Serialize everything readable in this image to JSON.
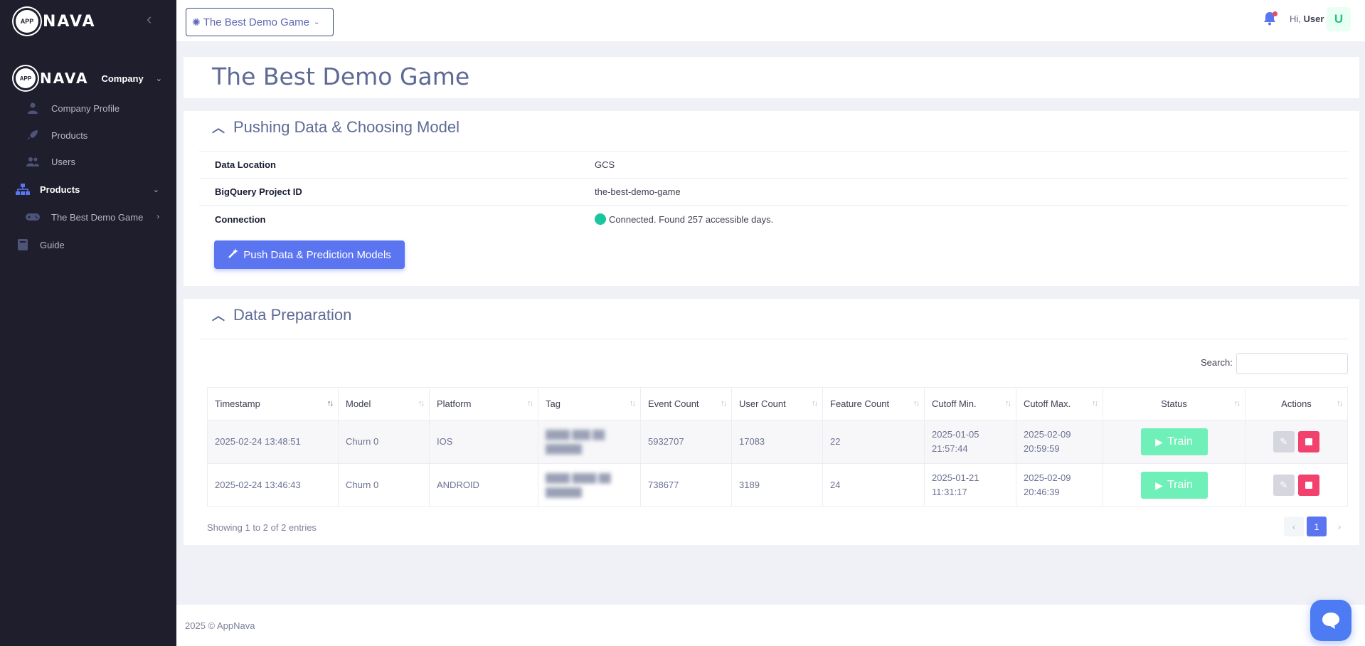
{
  "brand": {
    "logo_text": "NAVA",
    "logo_badge": "APP"
  },
  "sidebar": {
    "company_label": "Company",
    "company_items": [
      {
        "label": "Company Profile",
        "icon": "user-icon"
      },
      {
        "label": "Products",
        "icon": "rocket-icon"
      },
      {
        "label": "Users",
        "icon": "users-icon"
      }
    ],
    "products_label": "Products",
    "product_items": [
      {
        "label": "The Best Demo Game",
        "icon": "gamepad-icon"
      }
    ],
    "guide_label": "Guide"
  },
  "topbar": {
    "selected_product": "The Best Demo Game",
    "greeting": "Hi,",
    "user_name": "User",
    "avatar_letter": "U"
  },
  "page": {
    "title": "The Best Demo Game"
  },
  "pushing": {
    "section_title": "Pushing Data & Choosing Model",
    "rows": [
      {
        "key": "Data Location",
        "value": "GCS"
      },
      {
        "key": "BigQuery Project ID",
        "value": "the-best-demo-game"
      },
      {
        "key": "Connection",
        "value": "Connected. Found 257 accessible days."
      }
    ],
    "push_button": "Push Data & Prediction Models"
  },
  "prep": {
    "section_title": "Data Preparation",
    "search_label": "Search:",
    "search_value": "",
    "columns": [
      "Timestamp",
      "Model",
      "Platform",
      "Tag",
      "Event Count",
      "User Count",
      "Feature Count",
      "Cutoff Min.",
      "Cutoff Max.",
      "Status",
      "Actions"
    ],
    "rows": [
      {
        "timestamp": "2025-02-24 13:48:51",
        "model": "Churn 0",
        "platform": "IOS",
        "tag": "",
        "event_count": "5932707",
        "user_count": "17083",
        "feature_count": "22",
        "cutoff_min": "2025-01-05 21:57:44",
        "cutoff_max": "2025-02-09 20:59:59",
        "status_label": "Train"
      },
      {
        "timestamp": "2025-02-24 13:46:43",
        "model": "Churn 0",
        "platform": "ANDROID",
        "tag": "",
        "event_count": "738677",
        "user_count": "3189",
        "feature_count": "24",
        "cutoff_min": "2025-01-21 11:31:17",
        "cutoff_max": "2025-02-09 20:46:39",
        "status_label": "Train"
      }
    ],
    "showing": "Showing 1 to 2 of 2 entries",
    "current_page": "1"
  },
  "footer": {
    "text": "2025 © AppNava"
  },
  "colors": {
    "accent": "#5b74f0",
    "sidebar_bg": "#1e1e2d",
    "success": "#1bc5a0",
    "danger": "#f1416c",
    "train": "#6ef0b8"
  }
}
